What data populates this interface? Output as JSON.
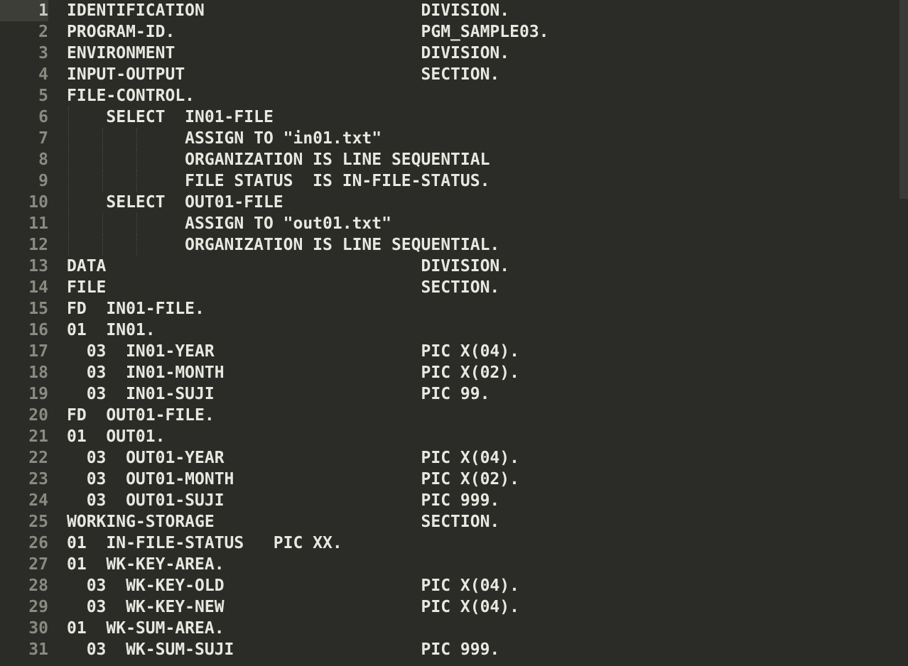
{
  "editor": {
    "currentLine": 1,
    "lines": [
      {
        "num": 1,
        "indent": 0,
        "guides": 0,
        "col1": "IDENTIFICATION",
        "col2": "DIVISION."
      },
      {
        "num": 2,
        "indent": 0,
        "guides": 0,
        "col1": "PROGRAM-ID.",
        "col2": "PGM_SAMPLE03."
      },
      {
        "num": 3,
        "indent": 0,
        "guides": 0,
        "col1": "ENVIRONMENT",
        "col2": "DIVISION."
      },
      {
        "num": 4,
        "indent": 0,
        "guides": 0,
        "col1": "INPUT-OUTPUT",
        "col2": "SECTION."
      },
      {
        "num": 5,
        "indent": 0,
        "guides": 0,
        "col1": "FILE-CONTROL.",
        "col2": ""
      },
      {
        "num": 6,
        "indent": 4,
        "guides": 1,
        "col1": "SELECT  IN01-FILE",
        "col2": ""
      },
      {
        "num": 7,
        "indent": 12,
        "guides": 3,
        "col1": "ASSIGN TO \"in01.txt\"",
        "col2": ""
      },
      {
        "num": 8,
        "indent": 12,
        "guides": 3,
        "col1": "ORGANIZATION IS LINE SEQUENTIAL",
        "col2": ""
      },
      {
        "num": 9,
        "indent": 12,
        "guides": 3,
        "col1": "FILE STATUS  IS IN-FILE-STATUS.",
        "col2": ""
      },
      {
        "num": 10,
        "indent": 4,
        "guides": 1,
        "col1": "SELECT  OUT01-FILE",
        "col2": ""
      },
      {
        "num": 11,
        "indent": 12,
        "guides": 3,
        "col1": "ASSIGN TO \"out01.txt\"",
        "col2": ""
      },
      {
        "num": 12,
        "indent": 12,
        "guides": 3,
        "col1": "ORGANIZATION IS LINE SEQUENTIAL.",
        "col2": ""
      },
      {
        "num": 13,
        "indent": 0,
        "guides": 0,
        "col1": "DATA",
        "col2": "DIVISION."
      },
      {
        "num": 14,
        "indent": 0,
        "guides": 0,
        "col1": "FILE",
        "col2": "SECTION."
      },
      {
        "num": 15,
        "indent": 0,
        "guides": 0,
        "col1": "FD  IN01-FILE.",
        "col2": ""
      },
      {
        "num": 16,
        "indent": 0,
        "guides": 0,
        "col1": "01  IN01.",
        "col2": ""
      },
      {
        "num": 17,
        "indent": 1,
        "guides": 0,
        "col1": " 03  IN01-YEAR",
        "col2": "PIC X(04)."
      },
      {
        "num": 18,
        "indent": 1,
        "guides": 0,
        "col1": " 03  IN01-MONTH",
        "col2": "PIC X(02)."
      },
      {
        "num": 19,
        "indent": 1,
        "guides": 0,
        "col1": " 03  IN01-SUJI",
        "col2": "PIC 99."
      },
      {
        "num": 20,
        "indent": 0,
        "guides": 0,
        "col1": "FD  OUT01-FILE.",
        "col2": ""
      },
      {
        "num": 21,
        "indent": 0,
        "guides": 0,
        "col1": "01  OUT01.",
        "col2": ""
      },
      {
        "num": 22,
        "indent": 1,
        "guides": 0,
        "col1": " 03  OUT01-YEAR",
        "col2": "PIC X(04)."
      },
      {
        "num": 23,
        "indent": 1,
        "guides": 0,
        "col1": " 03  OUT01-MONTH",
        "col2": "PIC X(02)."
      },
      {
        "num": 24,
        "indent": 1,
        "guides": 0,
        "col1": " 03  OUT01-SUJI",
        "col2": "PIC 999."
      },
      {
        "num": 25,
        "indent": 0,
        "guides": 0,
        "col1": "WORKING-STORAGE",
        "col2": "SECTION."
      },
      {
        "num": 26,
        "indent": 0,
        "guides": 0,
        "col1": "01  IN-FILE-STATUS   PIC XX.",
        "col2": ""
      },
      {
        "num": 27,
        "indent": 0,
        "guides": 0,
        "col1": "01  WK-KEY-AREA.",
        "col2": ""
      },
      {
        "num": 28,
        "indent": 1,
        "guides": 0,
        "col1": " 03  WK-KEY-OLD",
        "col2": "PIC X(04)."
      },
      {
        "num": 29,
        "indent": 1,
        "guides": 0,
        "col1": " 03  WK-KEY-NEW",
        "col2": "PIC X(04)."
      },
      {
        "num": 30,
        "indent": 0,
        "guides": 0,
        "col1": "01  WK-SUM-AREA.",
        "col2": ""
      },
      {
        "num": 31,
        "indent": 1,
        "guides": 0,
        "col1": " 03  WK-SUM-SUJI",
        "col2": "PIC 999."
      }
    ],
    "col2Position": 36
  }
}
